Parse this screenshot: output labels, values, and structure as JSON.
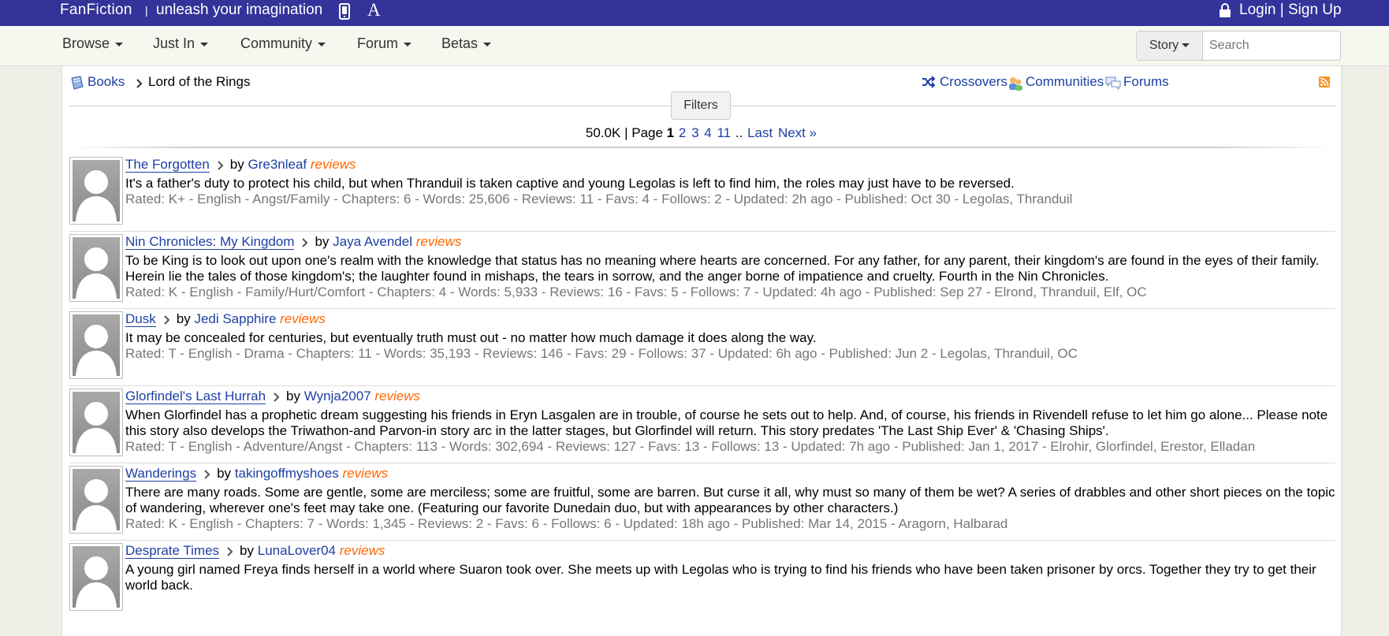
{
  "topbar": {
    "brand": "FanFiction",
    "separator": "|",
    "tagline": "unleash your imagination",
    "font_icon_letter": "A",
    "login": "Login | Sign Up",
    "color": "#333399"
  },
  "nav": {
    "items": [
      "Browse",
      "Just In",
      "Community",
      "Forum",
      "Betas"
    ]
  },
  "search": {
    "type_label": "Story",
    "placeholder": "Search"
  },
  "breadcrumb": {
    "root": "Books",
    "current": "Lord of the Rings"
  },
  "links": {
    "crossovers": "Crossovers",
    "communities": "Communities",
    "forums": "Forums"
  },
  "filters_label": "Filters",
  "pager": {
    "count": "50.0K",
    "page_label": "| Page",
    "current": "1",
    "pages": [
      "2",
      "3",
      "4",
      "11"
    ],
    "ellipsis": "..",
    "last": "Last",
    "next": "Next »"
  },
  "stories": [
    {
      "title": "The Forgotten",
      "by": "by",
      "author": "Gre3nleaf",
      "reviews": "reviews",
      "summary": "It's a father's duty to protect his child, but when Thranduil is taken captive and young Legolas is left to find him, the roles may just have to be reversed.",
      "meta": "Rated: K+ - English - Angst/Family - Chapters: 6 - Words: 25,606 - Reviews: 11 - Favs: 4 - Follows: 2 - Updated: 2h ago - Published: Oct 30 - Legolas, Thranduil"
    },
    {
      "title": "Nin Chronicles: My Kingdom",
      "by": "by",
      "author": "Jaya Avendel",
      "reviews": "reviews",
      "summary": "To be King is to look out upon one's realm with the knowledge that status has no meaning where hearts are concerned. For any father, for any parent, their kingdom's are found in the eyes of their family. Herein lie the tales of those kingdom's; the laughter found in mishaps, the tears in sorrow, and the anger borne of impatience and cruelty. Fourth in the Nin Chronicles.",
      "meta": "Rated: K - English - Family/Hurt/Comfort - Chapters: 4 - Words: 5,933 - Reviews: 16 - Favs: 5 - Follows: 7 - Updated: 4h ago - Published: Sep 27 - Elrond, Thranduil, Elf, OC"
    },
    {
      "title": "Dusk",
      "by": "by",
      "author": "Jedi Sapphire",
      "reviews": "reviews",
      "summary": "It may be concealed for centuries, but eventually truth must out - no matter how much damage it does along the way.",
      "meta": "Rated: T - English - Drama - Chapters: 11 - Words: 35,193 - Reviews: 146 - Favs: 29 - Follows: 37 - Updated: 6h ago - Published: Jun 2 - Legolas, Thranduil, OC"
    },
    {
      "title": "Glorfindel's Last Hurrah",
      "by": "by",
      "author": "Wynja2007",
      "reviews": "reviews",
      "summary": "When Glorfindel has a prophetic dream suggesting his friends in Eryn Lasgalen are in trouble, of course he sets out to help. And, of course, his friends in Rivendell refuse to let him go alone... Please note this story also develops the Triwathon-and Parvon-in story arc in the latter stages, but Glorfindel will return. This story predates 'The Last Ship Ever' & 'Chasing Ships'.",
      "meta": "Rated: T - English - Adventure/Angst - Chapters: 113 - Words: 302,694 - Reviews: 127 - Favs: 13 - Follows: 13 - Updated: 7h ago - Published: Jan 1, 2017 - Elrohir, Glorfindel, Erestor, Elladan"
    },
    {
      "title": "Wanderings",
      "by": "by",
      "author": "takingoffmyshoes",
      "reviews": "reviews",
      "summary": "There are many roads. Some are gentle, some are merciless; some are fruitful, some are barren. But curse it all, why must so many of them be wet? A series of drabbles and other short pieces on the topic of wandering, wherever one's feet may take one. (Featuring our favorite Dunedain duo, but with appearances by other characters.)",
      "meta": "Rated: K - English - Chapters: 7 - Words: 1,345 - Reviews: 2 - Favs: 6 - Follows: 6 - Updated: 18h ago - Published: Mar 14, 2015 - Aragorn, Halbarad"
    },
    {
      "title": "Desprate Times",
      "by": "by",
      "author": "LunaLover04",
      "reviews": "reviews",
      "summary": "A young girl named Freya finds herself in a world where Suaron took over. She meets up with Legolas who is trying to find his friends who have been taken prisoner by orcs. Together they try to get their world back.",
      "meta": ""
    }
  ]
}
